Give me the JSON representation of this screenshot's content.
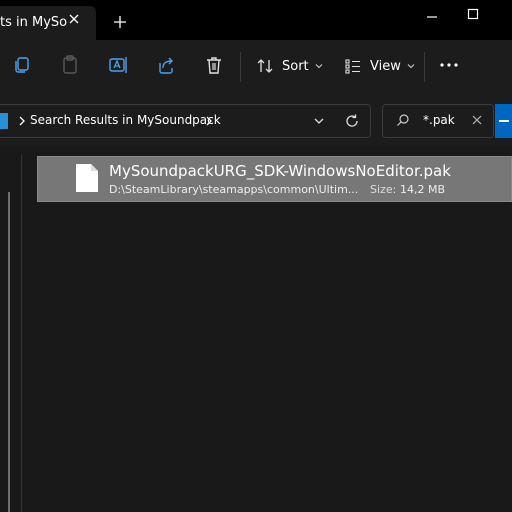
{
  "window": {
    "tab_title": "ts in MySo",
    "new_tab_symbol": "+"
  },
  "toolbar": {
    "sort_label": "Sort",
    "view_label": "View"
  },
  "address": {
    "breadcrumb": "Search Results in MySoundpack",
    "search_query": "*.pak"
  },
  "results": {
    "items": [
      {
        "name": "MySoundpackURG_SDK-WindowsNoEditor.pak",
        "path": "D:\\SteamLibrary\\steamapps\\common\\Ultim...",
        "size_label": "Size:",
        "size_value": "14,2 MB"
      }
    ]
  },
  "colors": {
    "accent": "#0067c0",
    "selection": "#777777",
    "background": "#191919",
    "titlebar": "#000000"
  },
  "icons": {
    "titlebar": [
      "close-icon",
      "plus-icon",
      "minimize-icon",
      "maximize-icon"
    ],
    "toolbar": [
      "copy-icon",
      "paste-icon",
      "rename-icon",
      "share-icon",
      "delete-icon",
      "sort-icon",
      "view-icon",
      "more-icon"
    ],
    "address": [
      "location-icon",
      "chevron-right-icon",
      "chevron-down-icon",
      "refresh-icon",
      "search-icon",
      "clear-icon"
    ],
    "results": [
      "file-icon"
    ]
  }
}
